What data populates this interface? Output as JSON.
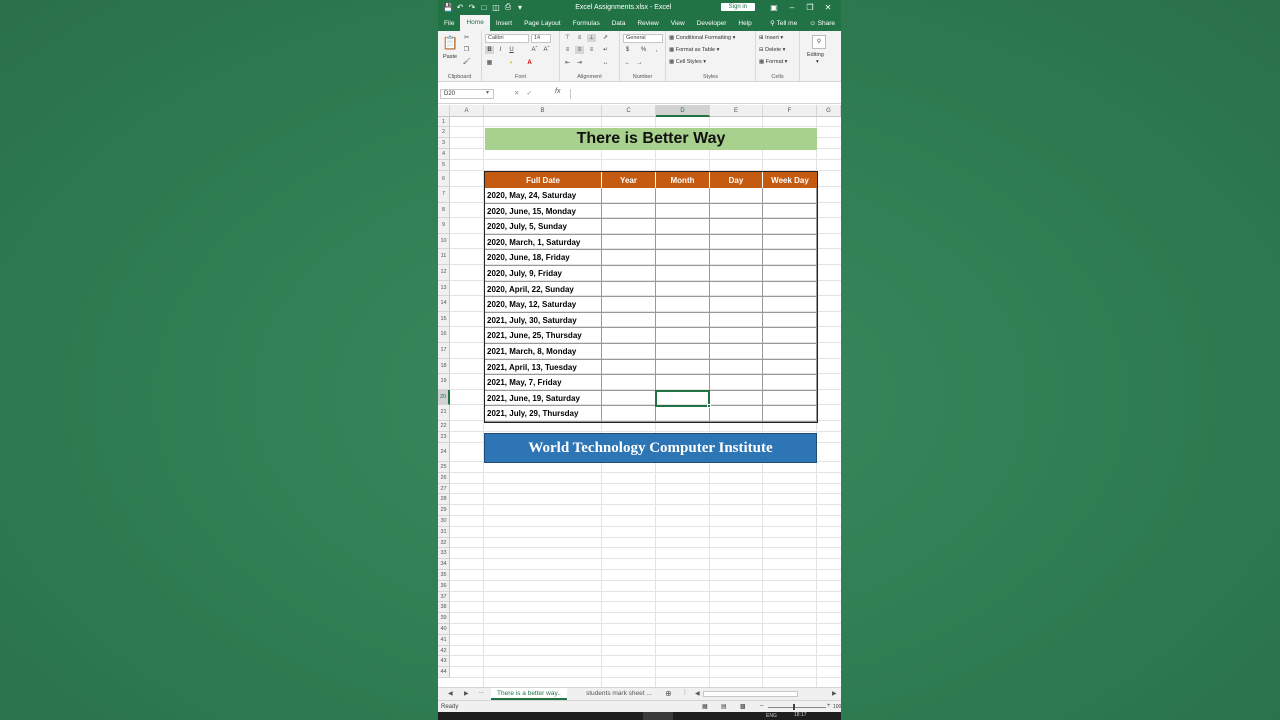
{
  "titlebar": {
    "title": "Excel Assignments.xlsx  -  Excel",
    "sign_in": "Sign in"
  },
  "menu": {
    "items": [
      "File",
      "Home",
      "Insert",
      "Page Layout",
      "Formulas",
      "Data",
      "Review",
      "View",
      "Developer",
      "Help"
    ],
    "active": "Home",
    "tell_me": "Tell me",
    "share": "Share"
  },
  "ribbon": {
    "groups": [
      "Clipboard",
      "Font",
      "Alignment",
      "Number",
      "Styles",
      "Cells"
    ],
    "paste": "Paste",
    "font_name": "Calibri",
    "font_size": "14",
    "number_format": "General",
    "conditional_formatting": "Conditional Formatting",
    "format_as_table": "Format as Table",
    "cell_styles": "Cell Styles",
    "insert": "Insert",
    "delete": "Delete",
    "format": "Format",
    "editing": "Editing"
  },
  "formula_bar": {
    "name_box": "D20",
    "fx": "fx",
    "value": ""
  },
  "grid": {
    "columns": [
      "A",
      "B",
      "C",
      "D",
      "E",
      "F",
      "G"
    ],
    "selected_column": "D",
    "selected_row": "20",
    "title": "There is Better Way",
    "headers": [
      "Full Date",
      "Year",
      "Month",
      "Day",
      "Week Day"
    ],
    "rows": [
      "2020, May, 24, Saturday",
      "2020, June, 15, Monday",
      "2020, July, 5, Sunday",
      "2020, March, 1, Saturday",
      "2020, June, 18, Friday",
      "2020, July, 9, Friday",
      "2020, April, 22, Sunday",
      "2020, May, 12, Saturday",
      "2021, July, 30, Saturday",
      "2021, June, 25, Thursday",
      "2021, March, 8, Monday",
      "2021, April, 13, Tuesday",
      "2021, May, 7, Friday",
      "2021, June, 19, Saturday",
      "2021, July, 29, Thursday"
    ],
    "footer": "World Technology Computer Institute"
  },
  "sheets": {
    "tabs": [
      "There is a better way..",
      "students mark sheet ..."
    ],
    "active": 0,
    "ellipsis": "..."
  },
  "status": {
    "ready": "Ready",
    "zoom": "100",
    "lang": "ENG",
    "time": "18:17"
  }
}
